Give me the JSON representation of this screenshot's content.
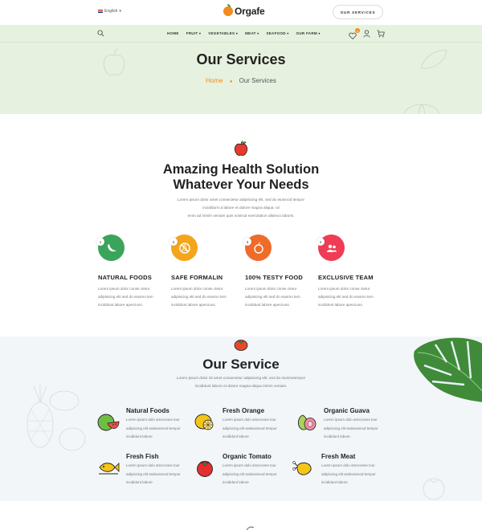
{
  "topbar": {
    "language": "English",
    "logo_text": "Orgafe",
    "services_button": "OUR SERVICES"
  },
  "nav": {
    "links": [
      {
        "label": "HOME",
        "dropdown": false
      },
      {
        "label": "FRUIT",
        "dropdown": true
      },
      {
        "label": "VEGETABLES",
        "dropdown": true
      },
      {
        "label": "MEAT",
        "dropdown": true
      },
      {
        "label": "SEAFOOD",
        "dropdown": true
      },
      {
        "label": "OUR FARM",
        "dropdown": true
      }
    ],
    "wishlist_count": "0"
  },
  "hero": {
    "title": "Our Services",
    "breadcrumb_home": "Home",
    "breadcrumb_current": "Our Services"
  },
  "intro": {
    "title_line1": "Amazing Health Solution",
    "title_line2": "Whatever Your Needs",
    "text_line1": "Lorem ipsum dolor amet consectetur adipisicing elit, sed do eiusmod tempor",
    "text_line2": "incididunt ut labore et dolore magna aliqua. Ut",
    "text_line3": "enim ad minim veniam quis nostrud exercitation ullamco laboris."
  },
  "features": [
    {
      "num": "1",
      "title": "NATURAL FOODS",
      "text": "Lorem ipsum dolor conse ctetur adipisicing elit sed do eiusmo tem incididunt labore aperciuns.",
      "color": "#3aa55a",
      "icon": "banana-icon"
    },
    {
      "num": "2",
      "title": "SAFE FORMALIN",
      "text": "Lorem ipsum dolor conse ctetur adipisicing elit sed do eiusmo tem incididunt labore aperciuns.",
      "color": "#f3a51c",
      "icon": "no-chemical-icon"
    },
    {
      "num": "3",
      "title": "100% TESTY FOOD",
      "text": "Lorem ipsum dolor conse ctetur adipisicing elit sed do eiusmo tem incididunt labore aperciuns.",
      "color": "#ef6b2a",
      "icon": "fruit-icon"
    },
    {
      "num": "4",
      "title": "EXCLUSIVE TEAM",
      "text": "Lorem ipsum dolor conse ctetur adipisicing elit sed do eiusmo tem incididunt labore aperciuns.",
      "color": "#ee3d55",
      "icon": "team-icon"
    }
  ],
  "service": {
    "title": "Our Service",
    "text_line1": "Lorem ipsum dolor sit amet consectetur adipisicing elit, sed do eiusmotempor",
    "text_line2": "incididunt labore et dolore magna aliqua minim veniam.",
    "items": [
      {
        "title": "Natural Foods",
        "text": "Lorem ipsum dolo amecones tour adipiscing elit sedeuismod tempor incididunt labore",
        "icon": "watermelon-icon"
      },
      {
        "title": "Fresh Orange",
        "text": "Lorem ipsum dolo amecones tour adipiscing elit sedeuismod tempor incididunt labore",
        "icon": "orange-icon"
      },
      {
        "title": "Organic Guava",
        "text": "Lorem ipsum dolo amecones tour adipiscing elit sedeuismod tempor incididunt labore",
        "icon": "guava-icon"
      },
      {
        "title": "Fresh Fish",
        "text": "Lorem ipsum dolo amecones tour adipiscing elit sedeuismod tempor incididunt labore",
        "icon": "fish-icon"
      },
      {
        "title": "Organic Tomato",
        "text": "Lorem ipsum dolo amecones tour adipiscing elit sedeuismod tempor incididunt labore",
        "icon": "tomato-icon"
      },
      {
        "title": "Fresh Meat",
        "text": "Lorem ipsum dolo amecones tour adipiscing elit sedeuismod tempor incididunt labore",
        "icon": "chicken-icon"
      }
    ]
  }
}
